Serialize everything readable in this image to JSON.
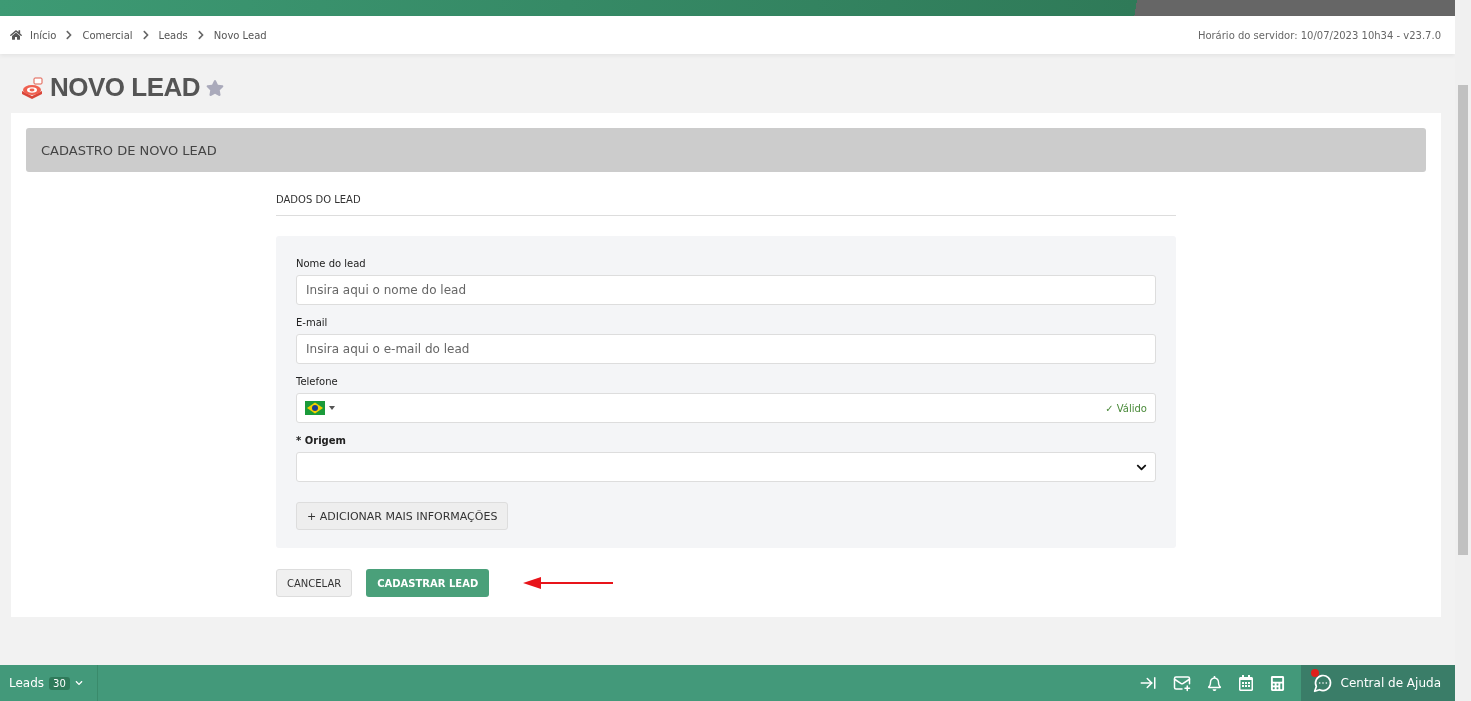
{
  "breadcrumb": {
    "items": [
      "Início",
      "Comercial",
      "Leads",
      "Novo Lead"
    ],
    "server_time": "Horário do servidor: 10/07/2023 10h34 - v23.7.0"
  },
  "page": {
    "title": "NOVO LEAD",
    "favorite": false
  },
  "card": {
    "header": "CADASTRO DE NOVO LEAD",
    "section": "DADOS DO LEAD",
    "fields": [
      {
        "kind": "text",
        "label": "Nome do lead",
        "required": false,
        "placeholder": "Insira aqui o nome do lead"
      },
      {
        "kind": "text",
        "label": "E-mail",
        "required": false,
        "placeholder": "Insira aqui o e-mail do lead"
      },
      {
        "kind": "phone",
        "label": "Telefone",
        "required": false,
        "status": "✓ Válido"
      },
      {
        "kind": "select",
        "label": "Origem",
        "required": true,
        "required_mark": "*"
      }
    ],
    "more_button": "+ ADICIONAR MAIS INFORMAÇÕES",
    "cancel_button": "CANCELAR",
    "submit_button": "CADASTRAR LEAD"
  },
  "footer": {
    "module": "Leads",
    "count": "30",
    "help": "Central de Ajuda",
    "help_notification": true
  }
}
